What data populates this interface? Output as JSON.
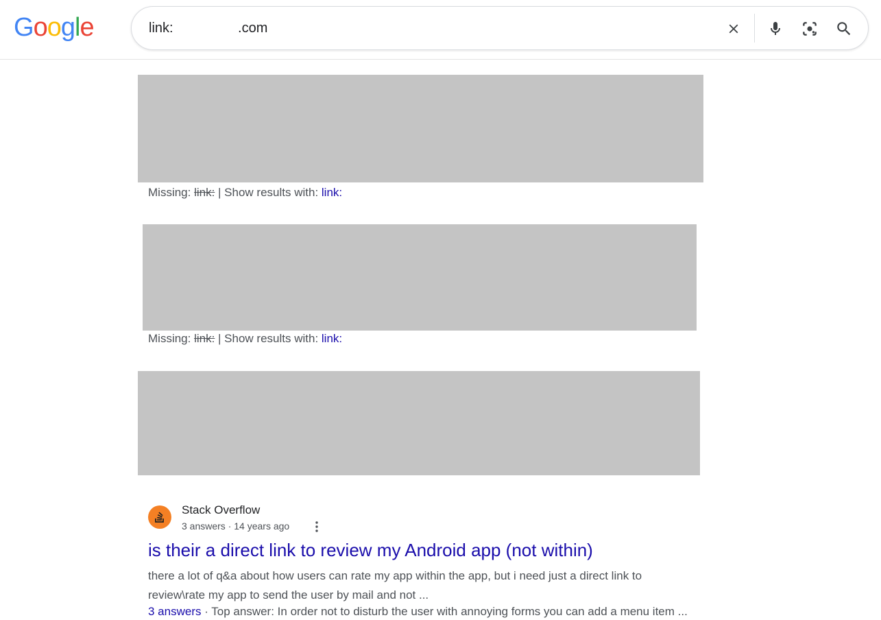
{
  "logo": {
    "letters": [
      "G",
      "o",
      "o",
      "g",
      "l",
      "e"
    ],
    "colors": [
      "#4285F4",
      "#EA4335",
      "#FBBC05",
      "#4285F4",
      "#34A853",
      "#EA4335"
    ]
  },
  "search": {
    "value": "link:                 .com",
    "clear_icon": "close-icon",
    "voice_icon": "microphone-icon",
    "lens_icon": "camera-lens-icon",
    "search_icon": "search-icon"
  },
  "missing_rows": [
    {
      "prefix": "Missing: ",
      "struck": "link:",
      "separator": " | Show results with: ",
      "link": "link:"
    },
    {
      "prefix": "Missing: ",
      "struck": "link:",
      "separator": " | Show results with: ",
      "link": "link:"
    }
  ],
  "result": {
    "favicon_icon": "stack-overflow-icon",
    "site_name": "Stack Overflow",
    "meta": "3 answers · 14 years ago",
    "more_icon": "more-vert-icon",
    "title": "is their a direct link to review my Android app (not within)",
    "snippet": "there a lot of q&a about how users can rate my app within the app, but i need just a direct link to review\\rate my app to send the user by mail and not ...",
    "answers_link": "3 answers",
    "answers_rest": " · Top answer: In order not to disturb the user with annoying forms you can add a menu item ..."
  },
  "colors": {
    "link": "#1a0dab",
    "redaction": "#c4c4c4",
    "favicon_bg": "#f48024"
  }
}
